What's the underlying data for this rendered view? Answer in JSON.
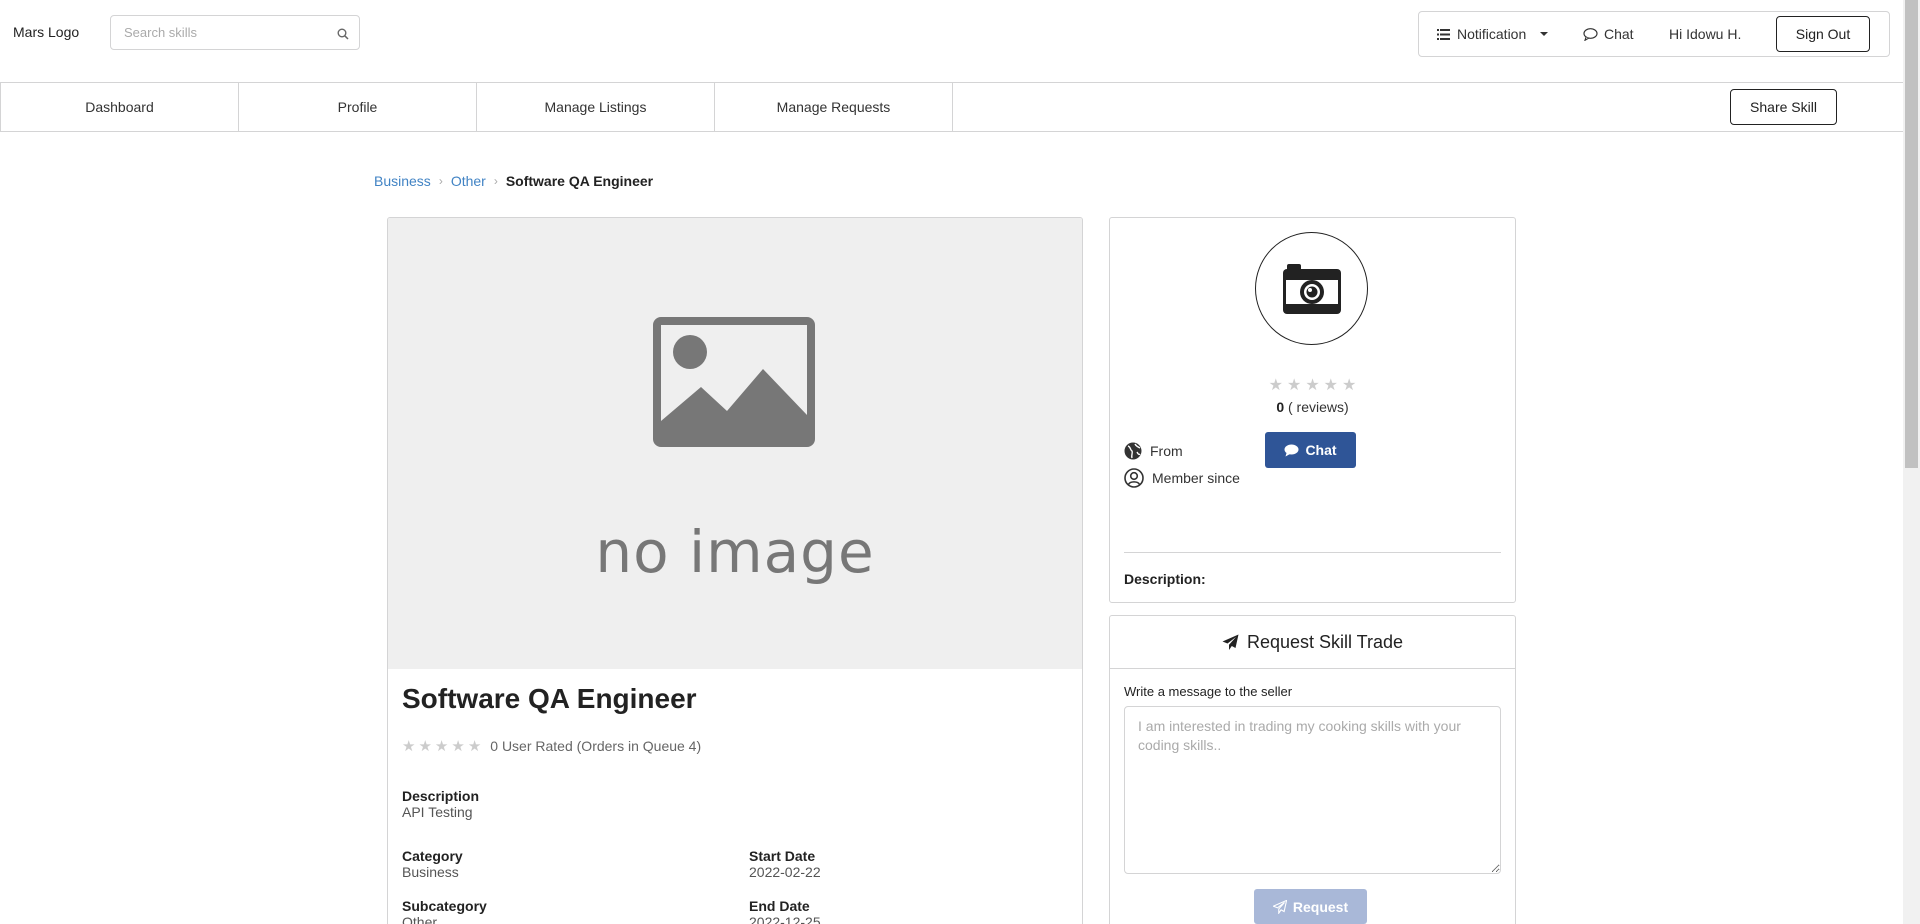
{
  "header": {
    "logo": "Mars Logo",
    "search_placeholder": "Search skills",
    "notification_label": "Notification",
    "chat_label": "Chat",
    "greeting": "Hi Idowu H.",
    "signout_label": "Sign Out"
  },
  "nav": {
    "items": [
      {
        "label": "Dashboard"
      },
      {
        "label": "Profile"
      },
      {
        "label": "Manage Listings"
      },
      {
        "label": "Manage Requests"
      }
    ],
    "share_label": "Share Skill"
  },
  "breadcrumb": {
    "items": [
      "Business",
      "Other"
    ],
    "current": "Software QA Engineer"
  },
  "listing": {
    "no_image_text": "no image",
    "title": "Software QA Engineer",
    "rating_text": "0 User Rated (Orders in Queue 4)",
    "rating_value": 0,
    "description_label": "Description",
    "description_value": "API Testing",
    "category_label": "Category",
    "category_value": "Business",
    "start_date_label": "Start Date",
    "start_date_value": "2022-02-22",
    "subcategory_label": "Subcategory",
    "subcategory_value": "Other",
    "end_date_label": "End Date",
    "end_date_value": "2022-12-25"
  },
  "seller": {
    "rating_value": 0,
    "reviews_count": "0",
    "reviews_suffix": "( reviews)",
    "chat_label": "Chat",
    "from_label": "From",
    "member_since_label": "Member since",
    "description_label": "Description:"
  },
  "request": {
    "title": "Request Skill Trade",
    "message_label": "Write a message to the seller",
    "message_placeholder": "I am interested in trading my cooking skills with your coding skills..",
    "button_label": "Request"
  },
  "colors": {
    "link": "#4183c4",
    "chat_button": "#2f5597",
    "request_button_disabled": "#a9b8d8",
    "border": "#d4d4d5"
  }
}
